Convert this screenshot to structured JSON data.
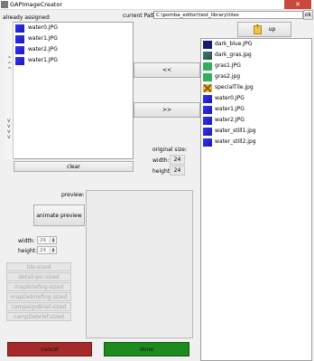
{
  "window": {
    "title": "GAPImageCreator",
    "close_glyph": "✕"
  },
  "assigned": {
    "label": "already assigned:",
    "items": [
      "water0.JPG",
      "water1.JPG",
      "water2.JPG",
      "water1.JPG"
    ],
    "clear_label": "clear"
  },
  "path": {
    "label": "current Path:",
    "value": "C:\\pomba_editor\\test_library\\tiles",
    "ok_label": "ok"
  },
  "nav": {
    "up_label": "up",
    "add_label": "<<",
    "remove_label": ">>"
  },
  "files": {
    "items": [
      {
        "name": "dark_blue.JPG",
        "thumb": "dark-blue"
      },
      {
        "name": "dark_gras.jpg",
        "thumb": "dark-gras"
      },
      {
        "name": "gras1.JPG",
        "thumb": "gras"
      },
      {
        "name": "gras2.jpg",
        "thumb": "gras"
      },
      {
        "name": "specialTile.jpg",
        "thumb": "special"
      },
      {
        "name": "water0.JPG",
        "thumb": "water"
      },
      {
        "name": "water1.JPG",
        "thumb": "water"
      },
      {
        "name": "water2.JPG",
        "thumb": "water"
      },
      {
        "name": "water_still1.jpg",
        "thumb": "water"
      },
      {
        "name": "water_still2.jpg",
        "thumb": "water"
      }
    ]
  },
  "original_size": {
    "label": "original size:",
    "width_label": "width:",
    "width": "24",
    "height_label": "height:",
    "height": "24"
  },
  "preview": {
    "label": "preview:",
    "animate_label": "animate preview"
  },
  "output_size": {
    "width_label": "width:",
    "width": "24",
    "height_label": "height:",
    "height": "24"
  },
  "size_buttons": [
    "tile-sized",
    "detail-pic-sized",
    "mapBriefing-sized",
    "mapDebriefing-sized",
    "campaignBrief-sized",
    "campDebrief-sized"
  ],
  "footer": {
    "cancel_label": "cancel",
    "done_label": "done"
  },
  "colors": {
    "cancel": "#a52a2a",
    "done": "#1d8a1d"
  }
}
